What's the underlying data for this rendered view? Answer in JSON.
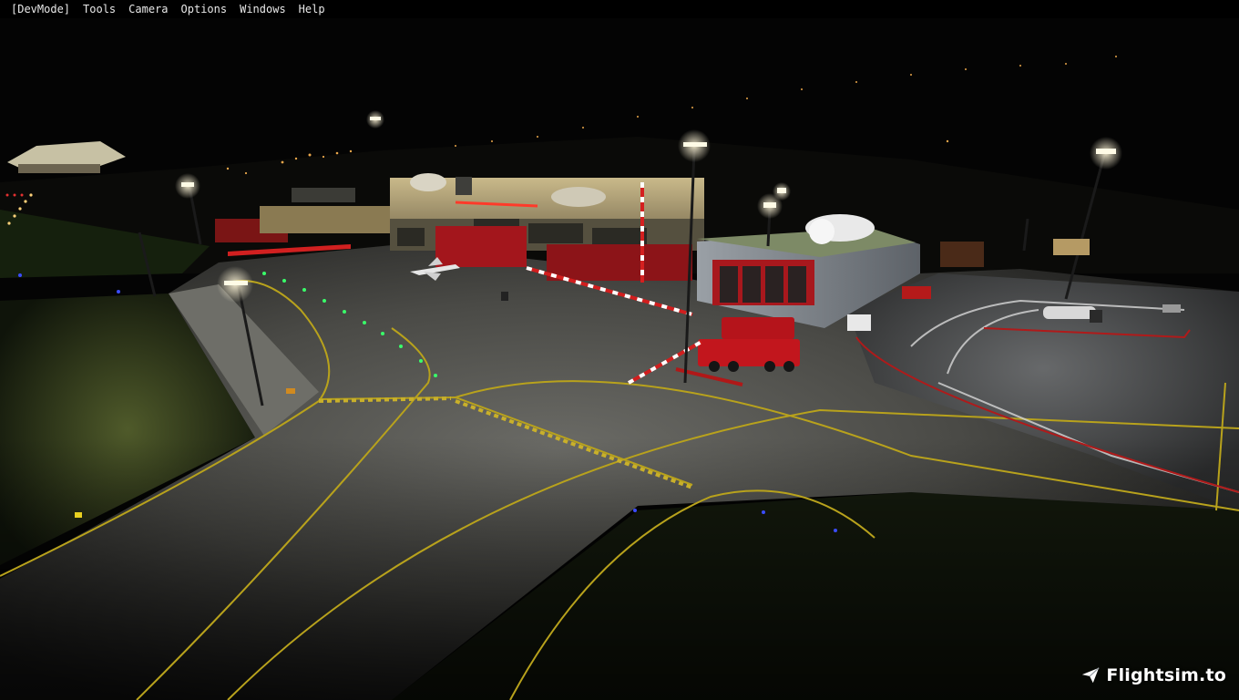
{
  "menubar": {
    "items": [
      {
        "label": "[DevMode]"
      },
      {
        "label": "Tools"
      },
      {
        "label": "Camera"
      },
      {
        "label": "Options"
      },
      {
        "label": "Windows"
      },
      {
        "label": "Help"
      }
    ]
  },
  "watermark": {
    "text": "Flightsim.to",
    "icon": "paper-plane-icon"
  },
  "scene": {
    "description_colors": {
      "sky": "#040404",
      "apron": "#4a4a48",
      "taxi_line": "#b8a21c",
      "terminal_red": "#a3161c",
      "grass": "#2d3a1c"
    }
  }
}
